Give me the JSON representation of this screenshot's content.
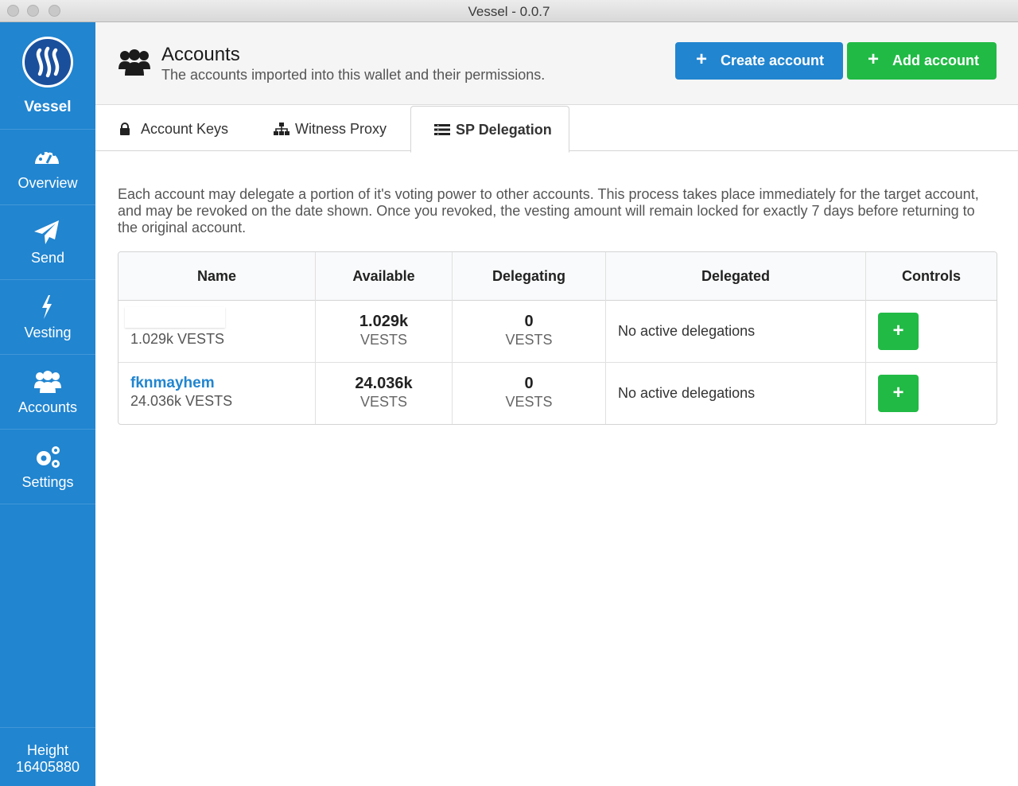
{
  "window": {
    "title": "Vessel - 0.0.7"
  },
  "sidebar": {
    "brand": "Vessel",
    "items": [
      {
        "label": "Overview",
        "icon": "dashboard-icon"
      },
      {
        "label": "Send",
        "icon": "paper-plane-icon"
      },
      {
        "label": "Vesting",
        "icon": "lightning-icon"
      },
      {
        "label": "Accounts",
        "icon": "users-icon"
      },
      {
        "label": "Settings",
        "icon": "settings-icon"
      }
    ],
    "height_label": "Height",
    "height_value": "16405880"
  },
  "header": {
    "title": "Accounts",
    "subtitle": "The accounts imported into this wallet and their permissions.",
    "create_button": "Create account",
    "add_button": "Add account"
  },
  "tabs": [
    {
      "label": "Account Keys",
      "icon": "lock-icon"
    },
    {
      "label": "Witness Proxy",
      "icon": "sitemap-icon"
    },
    {
      "label": "SP Delegation",
      "icon": "list-icon",
      "active": true
    }
  ],
  "description": "Each account may delegate a portion of it's voting power to other accounts. This process takes place immediately for the target account, and may be revoked on the date shown. Once you revoked, the vesting amount will remain locked for exactly 7 days before returning to the original account.",
  "table": {
    "headers": [
      "Name",
      "Available",
      "Delegating",
      "Delegated",
      "Controls"
    ],
    "rows": [
      {
        "name": "",
        "name_vests": "1.029k VESTS",
        "available": "1.029k",
        "available_unit": "VESTS",
        "delegating": "0",
        "delegating_unit": "VESTS",
        "delegated": "No active delegations",
        "control": "+"
      },
      {
        "name": "fknmayhem",
        "name_vests": "24.036k VESTS",
        "available": "24.036k",
        "available_unit": "VESTS",
        "delegating": "0",
        "delegating_unit": "VESTS",
        "delegated": "No active delegations",
        "control": "+"
      }
    ]
  },
  "colors": {
    "primary": "#2185d0",
    "success": "#21ba45"
  }
}
